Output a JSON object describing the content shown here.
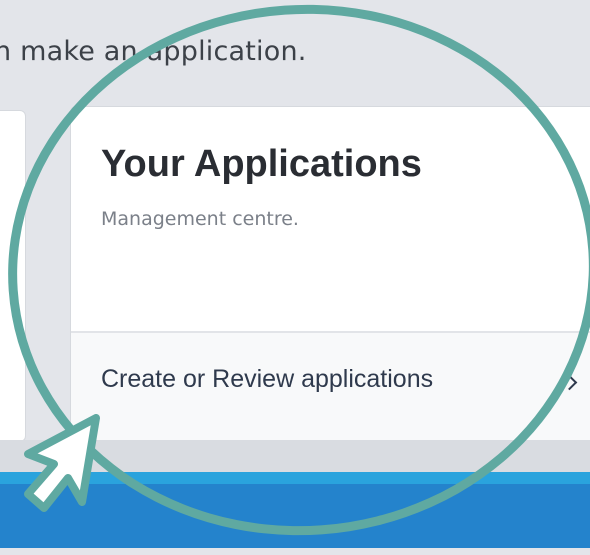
{
  "intro_text": "n make an application.",
  "card": {
    "title": "Your Applications",
    "subtitle": "Management centre.",
    "link_label": "Create or Review applications"
  },
  "colors": {
    "highlight_ring": "#5fa9a1",
    "cursor_fill": "#ffffff",
    "cursor_outline": "#5fa9a1",
    "footer_blue": "#2483cc",
    "footer_blue_light": "#2aa3dd"
  },
  "icons": {
    "chevron": "chevron-right-icon",
    "cursor": "mouse-pointer-icon"
  }
}
